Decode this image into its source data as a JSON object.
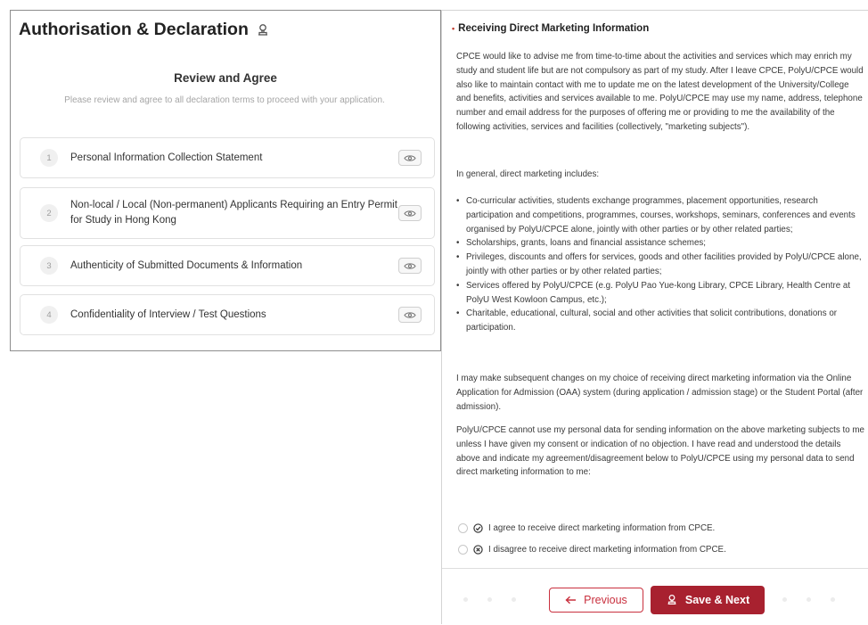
{
  "left": {
    "title": "Authorisation & Declaration",
    "review_heading": "Review and Agree",
    "review_sub": "Please review and agree to all declaration terms to proceed with your application.",
    "items": [
      {
        "num": "1",
        "label": "Personal Information Collection Statement"
      },
      {
        "num": "2",
        "label": "Non-local / Local (Non-permanent) Applicants Requiring an Entry Permit for Study in Hong Kong"
      },
      {
        "num": "3",
        "label": "Authenticity of Submitted Documents & Information"
      },
      {
        "num": "4",
        "label": "Confidentiality of Interview / Test Questions"
      }
    ]
  },
  "right": {
    "section_title": "Receiving Direct Marketing Information",
    "para1": "CPCE would like to advise me from time-to-time about the activities and services which may enrich my study and student life but are not compulsory as part of my study. After I leave CPCE, PolyU/CPCE would also like to maintain contact with me to update me on the latest development of the University/College and benefits, activities and services available to me. PolyU/CPCE may use my name, address, telephone number and email address for the purposes of offering me or providing to me the availability of the following activities, services and facilities (collectively, \"marketing subjects\").",
    "para2": "In general, direct marketing includes:",
    "bullets": [
      "Co-curricular activities, students exchange programmes, placement opportunities, research participation and competitions, programmes, courses, workshops, seminars, conferences and events organised by PolyU/CPCE alone, jointly with other parties or by other related parties;",
      "Scholarships, grants, loans and financial assistance schemes;",
      "Privileges, discounts and offers for services, goods and other facilities provided by PolyU/CPCE alone, jointly with other parties or by other related parties;",
      "Services offered by PolyU/CPCE (e.g. PolyU Pao Yue-kong Library, CPCE Library, Health Centre at PolyU West Kowloon Campus, etc.);",
      "Charitable, educational, cultural, social and other activities that solicit contributions, donations or participation."
    ],
    "para3": "I may make subsequent changes on my choice of receiving direct marketing information via the Online Application for Admission (OAA) system (during application / admission stage) or the Student Portal (after admission).",
    "para4": "PolyU/CPCE cannot use my personal data for sending information on the above marketing subjects to me unless I have given my consent or indication of no objection. I have read and understood the details above and indicate my agreement/disagreement below to PolyU/CPCE using my personal data to send direct marketing information to me:",
    "agree_label": "I agree to receive direct marketing information from CPCE.",
    "disagree_label": "I disagree to receive direct marketing information from CPCE."
  },
  "footer": {
    "prev_label": "Previous",
    "next_label": "Save & Next"
  },
  "colors": {
    "accent": "#a8212f",
    "accent_border": "#c9303e"
  }
}
